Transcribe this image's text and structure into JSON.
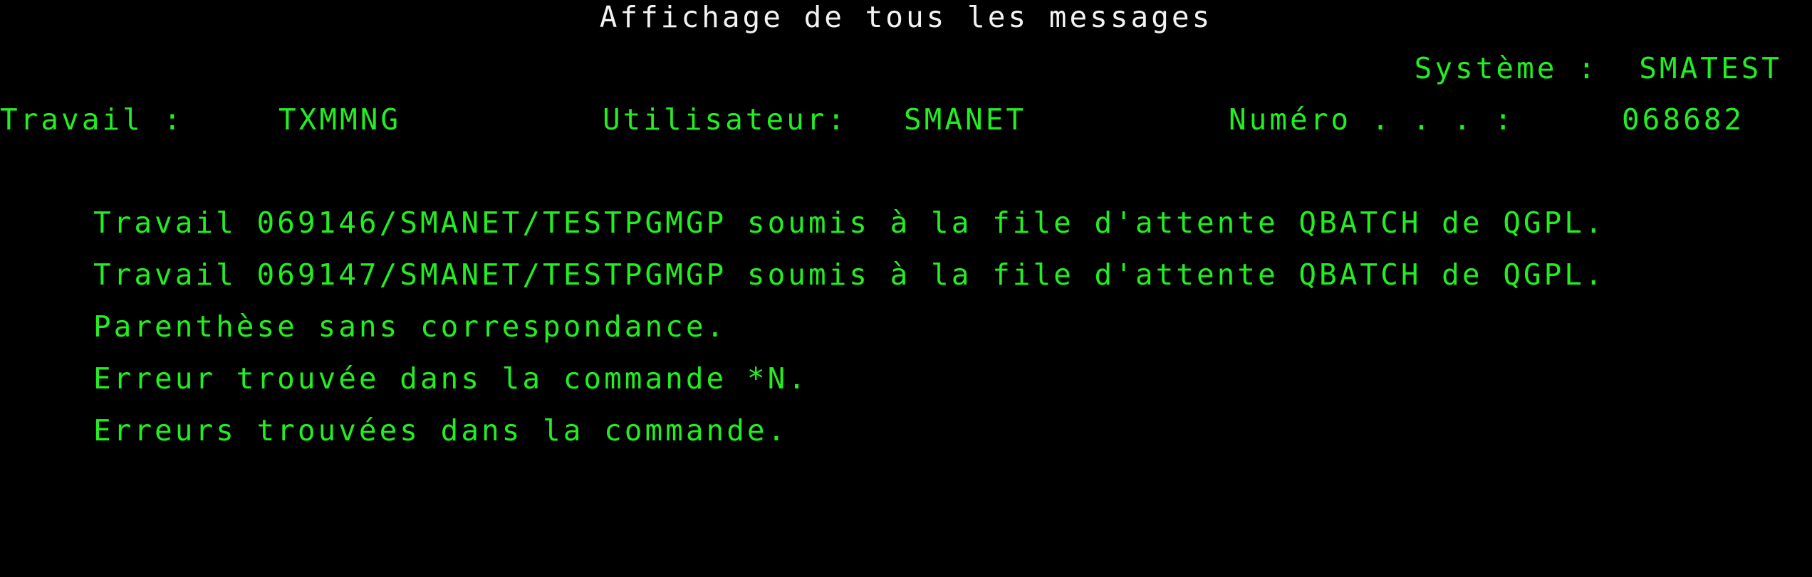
{
  "screen_title": "Affichage de tous les messages",
  "system": {
    "label": "Système :",
    "value": "SMATEST"
  },
  "job": {
    "label": "Travail :",
    "value": "TXMMNG",
    "user_label": "Utilisateur:",
    "user_value": "SMANET",
    "number_label": "Numéro . . . :",
    "number_value": "068682"
  },
  "messages": [
    "Travail 069146/SMANET/TESTPGMGP soumis à la file d'attente QBATCH de QGPL.",
    "Travail 069147/SMANET/TESTPGMGP soumis à la file d'attente QBATCH de QGPL.",
    "Parenthèse sans correspondance.",
    "Erreur trouvée dans la commande *N.",
    "Erreurs trouvées dans la commande."
  ],
  "colors": {
    "background": "#000000",
    "text_green": "#22ee22",
    "title_white": "#f2f2f2"
  }
}
